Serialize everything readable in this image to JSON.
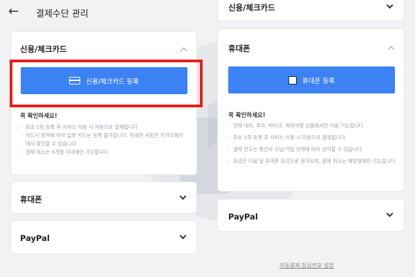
{
  "header": {
    "title": "결제수단 관리"
  },
  "left": {
    "card_section": {
      "title": "신용/체크카드",
      "button_label": "신용/체크카드 등록",
      "notice_title": "꼭 확인하세요!",
      "notices": [
        "최초 1회 등록 후 서비스 이용 시 자동으로 결제됩니다.",
        "카드사 정책에 따라 일부 카드는 등록 불가합니다. 자세한 사항은 카카오페이에서 확인할 수 있습니다.",
        "결제 취소는 6개월 이내에만 가능합니다."
      ]
    },
    "phone_section": {
      "title": "휴대폰"
    },
    "paypal_section": {
      "title": "PayPal"
    }
  },
  "right": {
    "card_section": {
      "title": "신용/체크카드"
    },
    "phone_section": {
      "title": "휴대폰",
      "button_label": "휴대폰 등록",
      "notice_title": "꼭 확인하세요!",
      "notices": [
        "현재 대리, 주차, 바이크, 해외여행 상품에서만 이용 가능합니다.",
        "최초 1회 등록 후 서비스 이용 시 자동으로 결제됩니다.",
        "결제 한도는 통신사 수납/가입 상태에 따라 상이할 수 있습니다.",
        "요금은 다음 달 휴대폰 요금으로 청구되며, 결제 취소는 해당월에만 가능합니다."
      ]
    },
    "paypal_section": {
      "title": "PayPal"
    },
    "footer_link": "자동결제 잠금번호 설정"
  },
  "colors": {
    "accent": "#3d82f3",
    "highlight": "#e8201d",
    "background": "#f1f2f4"
  },
  "icons": {
    "back": "arrow-left-icon",
    "card": "credit-card-icon",
    "phone": "phone-icon"
  }
}
